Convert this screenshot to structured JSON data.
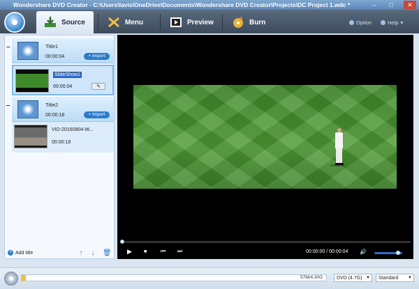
{
  "window": {
    "title": "Wondershare DVD Creator - C:\\Users\\lavis\\OneDrive\\Documents\\Wondershare DVD Creator\\Projects\\DC Project 1.wdc *",
    "minimize": "–",
    "maximize": "□",
    "close": "✕"
  },
  "toolbar": {
    "tabs": [
      {
        "label": "Source",
        "icon": "source-import-icon",
        "active": true
      },
      {
        "label": "Menu",
        "icon": "menu-icon",
        "active": false
      },
      {
        "label": "Preview",
        "icon": "preview-film-icon",
        "active": false
      },
      {
        "label": "Burn",
        "icon": "burn-icon",
        "active": false
      }
    ],
    "option_label": "Option",
    "help_label": "Help"
  },
  "titles": [
    {
      "name": "Title1",
      "duration": "00:00:04",
      "import_label": "+ Import",
      "collapse": "–"
    },
    {
      "name": "Title2",
      "duration": "00:00:18",
      "import_label": "+ Import",
      "collapse": "–"
    }
  ],
  "clips": [
    {
      "name": "SlideShow1",
      "duration": "00:00:04"
    },
    {
      "name": "VID-20160904-W...",
      "duration": "00:00:18"
    }
  ],
  "left_footer": {
    "add_title_label": "Add title"
  },
  "player": {
    "time_display": "00:00:00 / 00:00:04",
    "progress": 0,
    "volume": 0.85
  },
  "status": {
    "capacity_text": "57M/4.30G",
    "capacity_fraction": 0.013,
    "disc_type": "DVD (4.7G)",
    "quality": "Standard"
  }
}
